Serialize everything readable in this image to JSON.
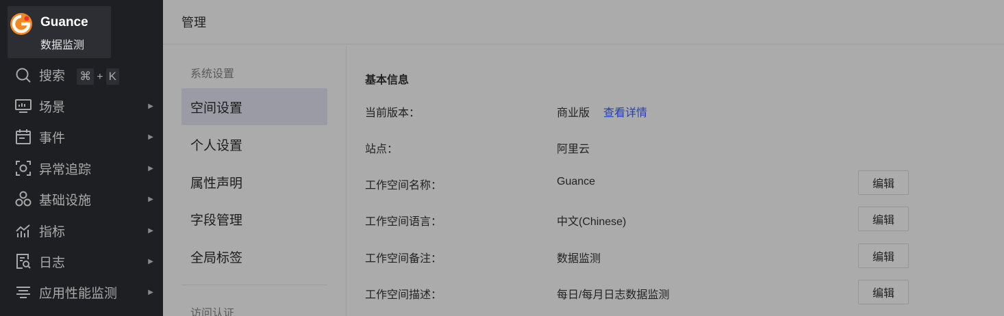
{
  "brand": {
    "name": "Guance",
    "subtitle": "数据监测"
  },
  "sidebar": {
    "search": {
      "label": "搜索",
      "shortcut_key1": "⌘",
      "shortcut_plus": "+",
      "shortcut_key2": "K"
    },
    "items": [
      {
        "label": "场景",
        "icon": "monitor-icon"
      },
      {
        "label": "事件",
        "icon": "calendar-icon"
      },
      {
        "label": "异常追踪",
        "icon": "target-icon"
      },
      {
        "label": "基础设施",
        "icon": "cluster-icon"
      },
      {
        "label": "指标",
        "icon": "chart-icon"
      },
      {
        "label": "日志",
        "icon": "log-search-icon"
      },
      {
        "label": "应用性能监测",
        "icon": "list-filter-icon"
      }
    ]
  },
  "header": {
    "title": "管理"
  },
  "settings_nav": {
    "group1_title": "系统设置",
    "items": [
      {
        "label": "空间设置",
        "active": true
      },
      {
        "label": "个人设置",
        "active": false
      },
      {
        "label": "属性声明",
        "active": false
      },
      {
        "label": "字段管理",
        "active": false
      },
      {
        "label": "全局标签",
        "active": false
      }
    ],
    "group2_title": "访问认证"
  },
  "panel": {
    "section_title": "基本信息",
    "rows": [
      {
        "label": "当前版本：",
        "value": "商业版",
        "link": "查看详情"
      },
      {
        "label": "站点：",
        "value": "阿里云"
      },
      {
        "label": "工作空间名称：",
        "value": "Guance",
        "button": "编辑"
      },
      {
        "label": "工作空间语言：",
        "value": "中文(Chinese)",
        "button": "编辑"
      },
      {
        "label": "工作空间备注：",
        "value": "数据监测",
        "button": "编辑"
      },
      {
        "label": "工作空间描述：",
        "value": "每日/每月日志数据监测",
        "button": "编辑"
      }
    ]
  },
  "colors": {
    "sidebar_bg": "#1e1f22",
    "overlay_bg": "#ababab",
    "active_item_bg": "#9a9ba4",
    "link": "#2441a8",
    "logo_orange": "#f5871f",
    "logo_red": "#e8372d"
  }
}
